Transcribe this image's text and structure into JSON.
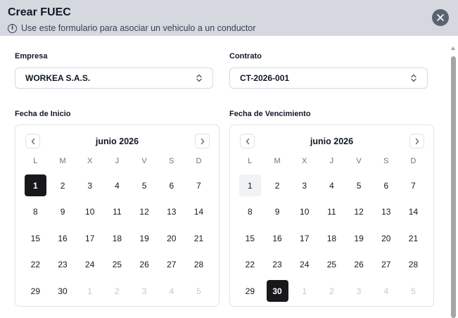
{
  "dialog": {
    "title": "Crear FUEC",
    "subtitle": "Use este formulario para asociar un vehiculo a un conductor"
  },
  "fields": {
    "empresa": {
      "label": "Empresa",
      "value": "WORKEA S.A.S."
    },
    "contrato": {
      "label": "Contrato",
      "value": "CT-2026-001"
    }
  },
  "calendars": {
    "weekdays": [
      "L",
      "M",
      "X",
      "J",
      "V",
      "S",
      "D"
    ],
    "start": {
      "label": "Fecha de Inicio",
      "month": "junio 2026",
      "selected_day": "1",
      "days": [
        "1",
        "2",
        "3",
        "4",
        "5",
        "6",
        "7",
        "8",
        "9",
        "10",
        "11",
        "12",
        "13",
        "14",
        "15",
        "16",
        "17",
        "18",
        "19",
        "20",
        "21",
        "22",
        "23",
        "24",
        "25",
        "26",
        "27",
        "28",
        "29",
        "30",
        "1",
        "2",
        "3",
        "4",
        "5"
      ]
    },
    "end": {
      "label": "Fecha de Vencimiento",
      "month": "junio 2026",
      "selected_day": "30",
      "today_day": "1",
      "days": [
        "1",
        "2",
        "3",
        "4",
        "5",
        "6",
        "7",
        "8",
        "9",
        "10",
        "11",
        "12",
        "13",
        "14",
        "15",
        "16",
        "17",
        "18",
        "19",
        "20",
        "21",
        "22",
        "23",
        "24",
        "25",
        "26",
        "27",
        "28",
        "29",
        "30",
        "1",
        "2",
        "3",
        "4",
        "5"
      ]
    }
  },
  "icons": {
    "info": "info-icon",
    "close": "close-icon",
    "select": "chevron-up-down-icon",
    "prev": "chevron-left-icon",
    "next": "chevron-right-icon"
  },
  "colors": {
    "header_bg": "#d5d8df",
    "selected_day_bg": "#18181b",
    "close_button_bg": "#5b6270"
  }
}
